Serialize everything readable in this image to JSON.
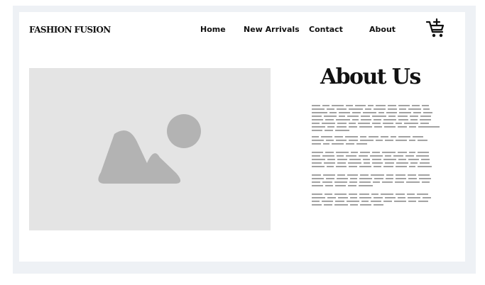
{
  "brand": "FASHION FUSION",
  "nav": {
    "home": "Home",
    "new_arrivals": "New Arrivals",
    "contact": "Contact",
    "about": "About"
  },
  "cart": {
    "icon": "cart-plus-icon"
  },
  "about": {
    "heading": "About Us"
  },
  "hero": {
    "icon": "image-placeholder-icon",
    "background": "#e4e4e4",
    "shape_color": "#b3b3b3"
  },
  "colors": {
    "text": "#111111",
    "placeholder_text": "#9a9a9a",
    "frame": "#eef1f5"
  }
}
